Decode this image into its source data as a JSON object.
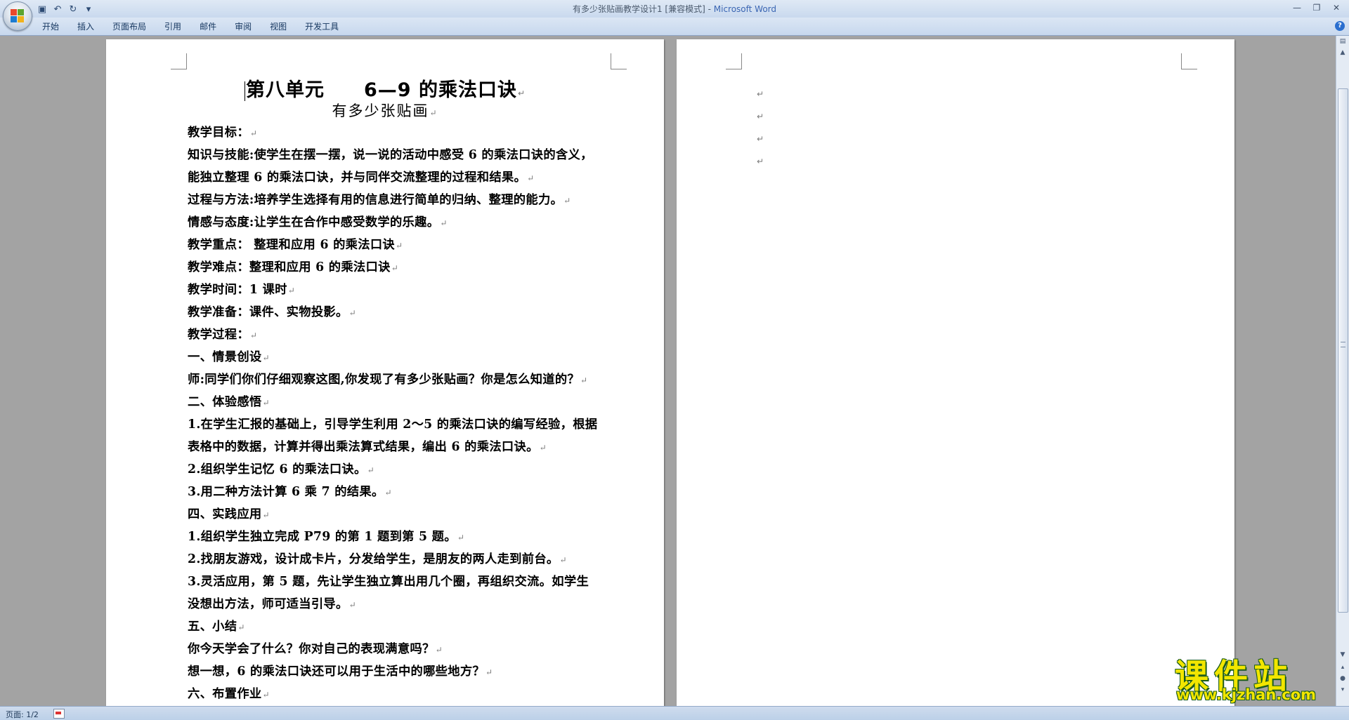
{
  "window": {
    "title": "有多少张贴画教学设计1 [兼容模式] - ",
    "app_name": "Microsoft Word"
  },
  "quick_access": [
    {
      "name": "save-icon",
      "glyph": "▣"
    },
    {
      "name": "undo-icon",
      "glyph": "↶"
    },
    {
      "name": "redo-icon",
      "glyph": "↻"
    },
    {
      "name": "customize-icon",
      "glyph": "▾"
    }
  ],
  "window_controls": [
    {
      "name": "minimize-icon",
      "glyph": "—"
    },
    {
      "name": "maximize-icon",
      "glyph": "❐"
    },
    {
      "name": "close-icon",
      "glyph": "✕"
    }
  ],
  "ribbon": {
    "tabs": [
      "开始",
      "插入",
      "页面布局",
      "引用",
      "邮件",
      "审阅",
      "视图",
      "开发工具"
    ],
    "help_glyph": "?"
  },
  "document": {
    "title": "第八单元　　6—9 的乘法口诀",
    "subtitle": "有多少张贴画",
    "paragraph_mark": "↵",
    "lines": [
      "教学目标：",
      "知识与技能:使学生在摆一摆，说一说的活动中感受 6 的乘法口诀的含义，",
      "能独立整理 6 的乘法口诀，并与同伴交流整理的过程和结果。",
      "过程与方法:培养学生选择有用的信息进行简单的归纳、整理的能力。",
      "情感与态度:让学生在合作中感受数学的乐趣。",
      "教学重点： 整理和应用 6 的乘法口诀",
      "教学难点：整理和应用 6 的乘法口诀",
      "教学时间：1 课时",
      "教学准备：课件、实物投影。",
      "教学过程：",
      "一、情景创设",
      "师:同学们你们仔细观察这图,你发现了有多少张贴画？你是怎么知道的？",
      "二、体验感悟",
      "1.在学生汇报的基础上，引导学生利用 2～5 的乘法口诀的编写经验，根据",
      "表格中的数据，计算并得出乘法算式结果，编出 6 的乘法口诀。",
      "2.组织学生记忆 6 的乘法口诀。",
      "3.用二种方法计算 6 乘 7 的结果。",
      "四、实践应用",
      "1.组织学生独立完成 P79 的第 1 题到第 5 题。",
      "2.找朋友游戏，设计成卡片，分发给学生，是朋友的两人走到前台。",
      "3.灵活应用，第 5 题，先让学生独立算出用几个圈，再组织交流。如学生",
      "没想出方法，师可适当引导。",
      "五、小结",
      "你今天学会了什么？你对自己的表现满意吗？",
      "想一想，6 的乘法口诀还可以用于生活中的哪些地方？",
      "六、布置作业"
    ],
    "line_has_mark": [
      true,
      false,
      true,
      true,
      true,
      true,
      true,
      true,
      true,
      true,
      true,
      true,
      true,
      false,
      true,
      true,
      true,
      true,
      true,
      true,
      false,
      true,
      true,
      true,
      true,
      true
    ],
    "page2_marks": [
      "↵",
      "↵",
      "↵",
      "↵"
    ]
  },
  "status": {
    "page": "页面: 1/2"
  },
  "watermark": {
    "text": "课件站",
    "url": "www.kjzhan.com"
  },
  "colors": {
    "office_logo": [
      "#e8482c",
      "#5da52f",
      "#1d7ccf",
      "#f2b21b"
    ]
  }
}
